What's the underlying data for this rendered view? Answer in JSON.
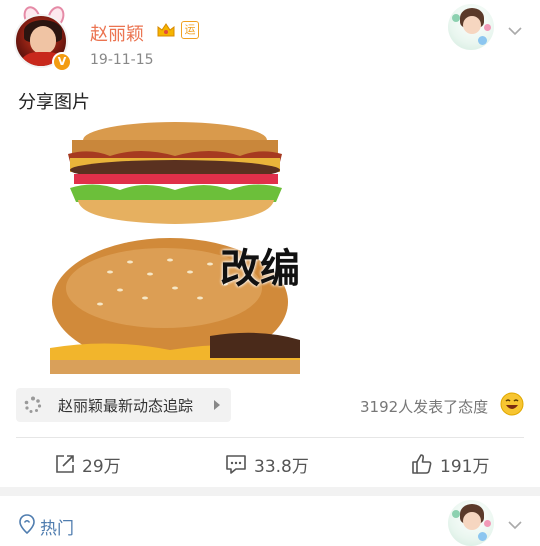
{
  "post": {
    "username": "赵丽颖",
    "vip_badge": "运",
    "verified_mark": "V",
    "timestamp": "19-11-15",
    "text": "分享图片",
    "image_overlay_text": "改编"
  },
  "topic": {
    "label": "赵丽颖最新动态追踪",
    "attitude_text": "3192人发表了态度"
  },
  "actions": {
    "repost_count": "29万",
    "comment_count": "33.8万",
    "like_count": "191万"
  },
  "next_section": {
    "label": "热门"
  },
  "colors": {
    "username": "#eb7350",
    "link": "#507daf",
    "separator": "#f2f2f2"
  }
}
